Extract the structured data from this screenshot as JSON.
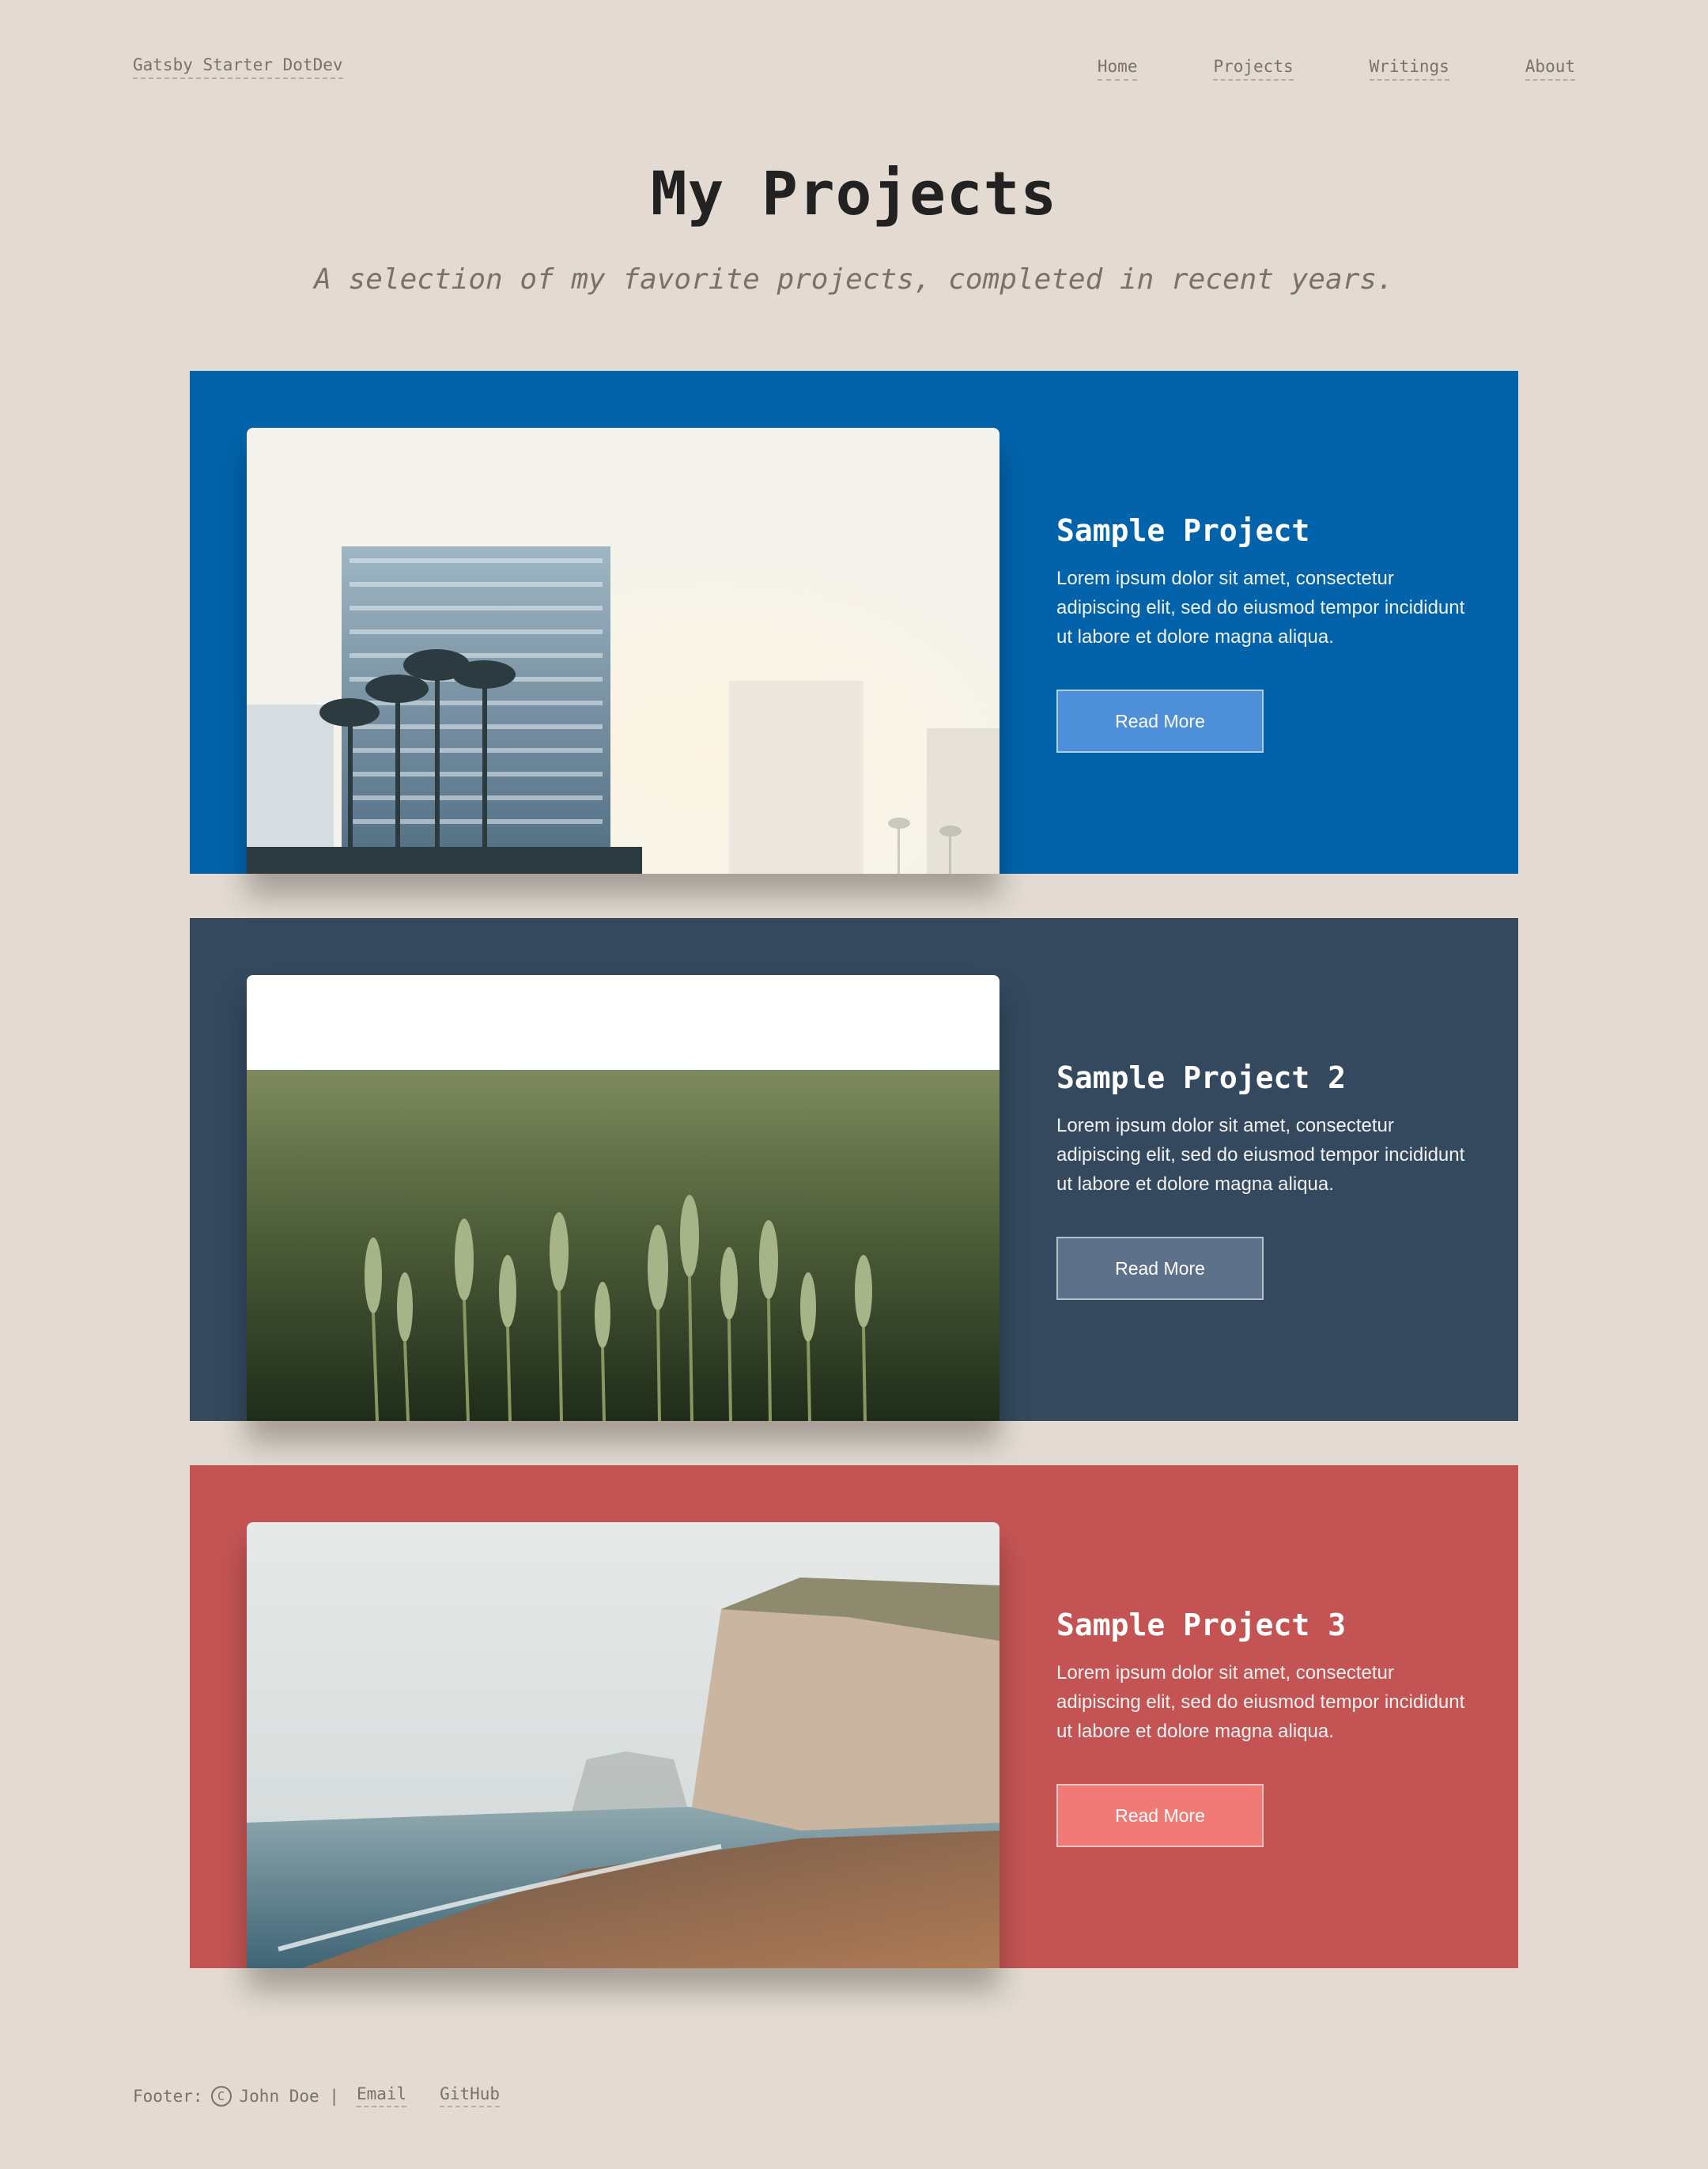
{
  "header": {
    "site_title": "Gatsby Starter DotDev",
    "nav": [
      "Home",
      "Projects",
      "Writings",
      "About"
    ]
  },
  "hero": {
    "title": "My Projects",
    "subtitle": "A selection of my favorite projects, completed in recent years."
  },
  "projects": [
    {
      "title": "Sample Project",
      "description": "Lorem ipsum dolor sit amet, consectetur adipiscing elit, sed do eiusmod tempor incididunt ut labore et dolore magna aliqua.",
      "button": "Read More",
      "bg_color": "#0263aa",
      "button_color": "#4d8fd8"
    },
    {
      "title": "Sample Project 2",
      "description": "Lorem ipsum dolor sit amet, consectetur adipiscing elit, sed do eiusmod tempor incididunt ut labore et dolore magna aliqua.",
      "button": "Read More",
      "bg_color": "#34495e",
      "button_color": "#5d718a"
    },
    {
      "title": "Sample Project 3",
      "description": "Lorem ipsum dolor sit amet, consectetur adipiscing elit, sed do eiusmod tempor incididunt ut labore et dolore magna aliqua.",
      "button": "Read More",
      "bg_color": "#c45454",
      "button_color": "#f07a75"
    }
  ],
  "footer": {
    "prefix": "Footer:",
    "copyright_icon": "copyright-icon",
    "copyright_symbol": "C",
    "author": "John Doe |",
    "links": [
      "Email",
      "GitHub"
    ]
  }
}
